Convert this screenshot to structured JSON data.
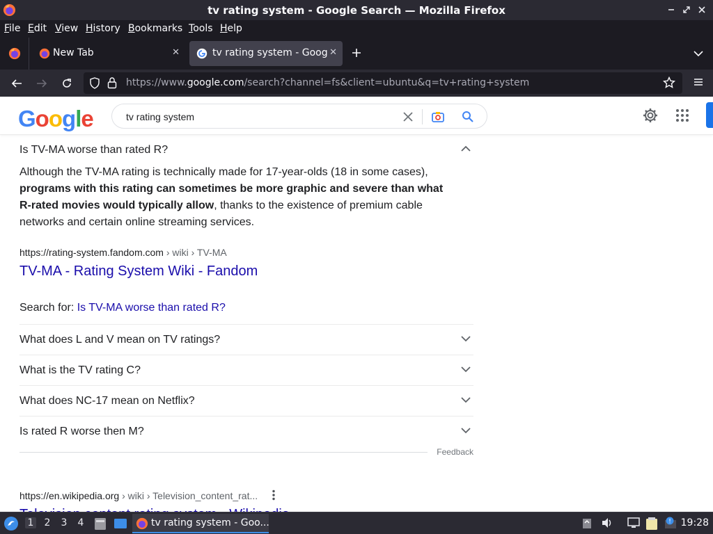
{
  "window": {
    "title": "tv rating system - Google Search — Mozilla Firefox",
    "controls": [
      "–",
      "⤡",
      "✕"
    ]
  },
  "menubar": {
    "items": [
      {
        "label": "File",
        "accel": "F",
        "rest": "ile"
      },
      {
        "label": "Edit",
        "accel": "E",
        "rest": "dit"
      },
      {
        "label": "View",
        "accel": "V",
        "rest": "iew"
      },
      {
        "label": "History",
        "accel": "H",
        "rest": "istory"
      },
      {
        "label": "Bookmarks",
        "accel": "B",
        "rest": "ookmarks"
      },
      {
        "label": "Tools",
        "accel": "T",
        "rest": "ools"
      },
      {
        "label": "Help",
        "accel": "H",
        "rest": "elp"
      }
    ]
  },
  "tabs": [
    {
      "label": "New Tab",
      "active": false
    },
    {
      "label": "tv rating system - Google Search",
      "active": true
    }
  ],
  "navbar": {
    "url_prefix": "https://www.",
    "url_host": "google.com",
    "url_rest": "/search?channel=fs&client=ubuntu&q=tv+rating+system"
  },
  "google": {
    "logo": "Google",
    "query": "tv rating system"
  },
  "results": {
    "expanded_question": "Is TV-MA worse than rated R?",
    "answer_pre": "Although the TV-MA rating is technically made for 17-year-olds (18 in some cases), ",
    "answer_bold": "programs with this rating can sometimes be more graphic and severe than what R-rated movies would typically allow",
    "answer_post": ", thanks to the existence of premium cable networks and certain online streaming services.",
    "source_domain": "https://rating-system.fandom.com",
    "source_path": " › wiki › TV-MA",
    "source_title": "TV-MA - Rating System Wiki - Fandom",
    "search_for_label": "Search for: ",
    "search_for_link": "Is TV-MA worse than rated R?",
    "questions": [
      "What does L and V mean on TV ratings?",
      "What is the TV rating C?",
      "What does NC-17 mean on Netflix?",
      "Is rated R worse then M?"
    ],
    "feedback": "Feedback",
    "next_domain": "https://en.wikipedia.org",
    "next_path": " › wiki › Television_content_rat...",
    "next_title": "Television content rating system - Wikipedia"
  },
  "taskbar": {
    "workspaces": [
      "1",
      "2",
      "3",
      "4"
    ],
    "active_workspace": "1",
    "window_label": "tv rating system - Goo...",
    "clock": "19:28"
  },
  "colors": {
    "link": "#1a0dab",
    "text": "#202124",
    "muted": "#5f6368",
    "chrome_dark": "#1c1b22",
    "chrome_mid": "#2b2a33"
  }
}
